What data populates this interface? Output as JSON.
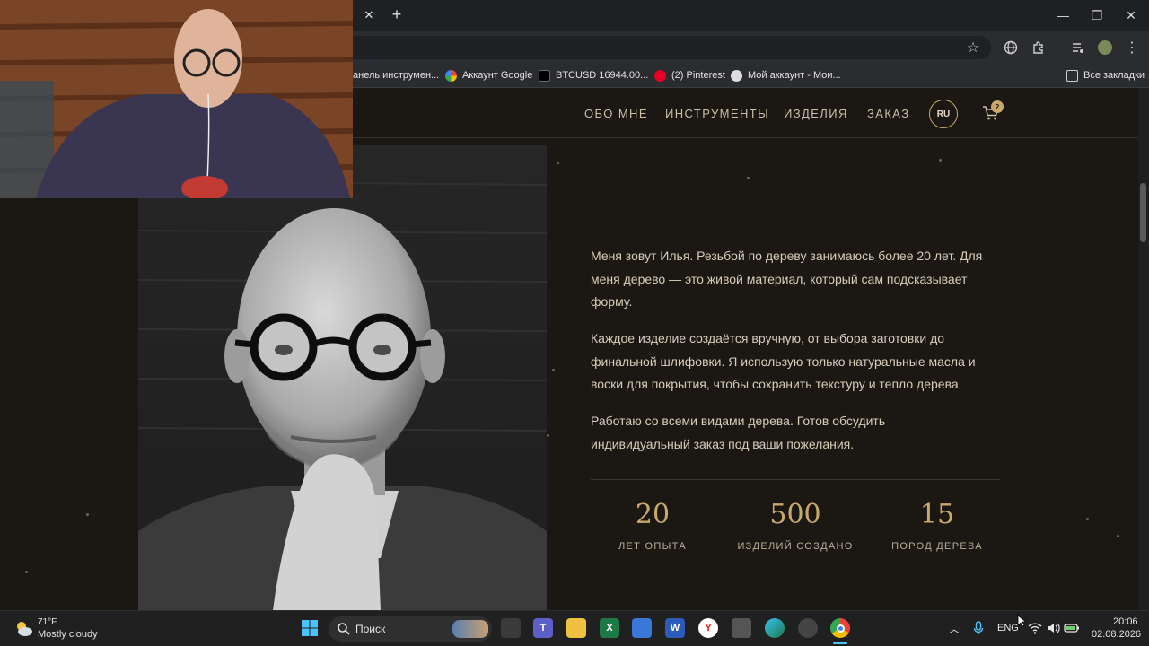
{
  "browser": {
    "bookmarks": [
      {
        "label": "анель инструмен...",
        "icon": "folder-icon"
      },
      {
        "label": "Аккаунт Google",
        "icon": "google-icon"
      },
      {
        "label": "BTCUSD 16944.00...",
        "icon": "tradingview-icon"
      },
      {
        "label": "(2) Pinterest",
        "icon": "pinterest-icon"
      },
      {
        "label": "Мой аккаунт - Мои...",
        "icon": "account-icon"
      }
    ],
    "all_bookmarks": "Все закладки"
  },
  "site": {
    "nav": {
      "about": "ОБО МНЕ",
      "tools": "ИНСТРУМЕНТЫ",
      "products": "ИЗДЕЛИЯ",
      "order": "ЗАКАЗ",
      "lang": "RU",
      "cart_count": "2"
    },
    "about": {
      "p1": "Меня зовут Илья. Резьбой по дереву занимаюсь более 20 лет. Для меня дерево — это живой материал, который сам подсказывает форму.",
      "p2": "Каждое изделие создаётся вручную, от выбора заготовки до финальной шлифовки. Я использую только натуральные масла и воски для покрытия, чтобы сохранить текстуру и тепло дерева.",
      "p3": "Работаю со всеми видами дерева. Готов обсудить индивидуальный заказ под ваши пожелания."
    },
    "stats": [
      {
        "value": "20",
        "label": "ЛЕТ ОПЫТА"
      },
      {
        "value": "500",
        "label": "ИЗДЕЛИЙ СОЗДАНО"
      },
      {
        "value": "15",
        "label": "ПОРОД ДЕРЕВА"
      }
    ],
    "accent_color": "#c8a96a"
  },
  "taskbar": {
    "weather_temp": "71°F",
    "weather_desc": "Mostly cloudy",
    "search_placeholder": "Поиск",
    "lang": "ENG",
    "time": "20:06",
    "date": "02.08.2026"
  }
}
